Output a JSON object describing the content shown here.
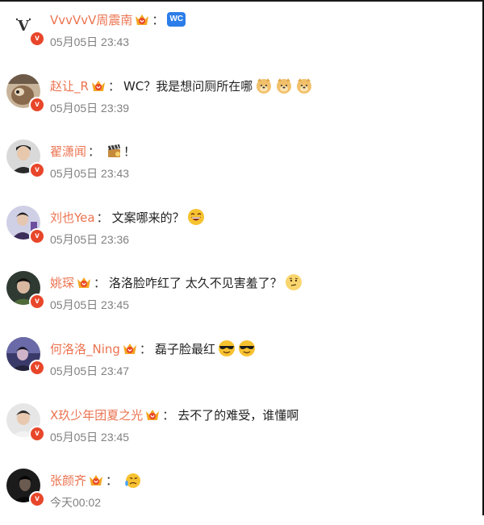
{
  "comments": [
    {
      "username": "VvvVvV周震南",
      "text": "",
      "time": "05月05日 23:43",
      "badge_text": "WC",
      "avatar": "v-logo-icon",
      "emojis": []
    },
    {
      "username": "赵让_R",
      "text": "WC？我是想问厕所在哪",
      "time": "05月05日 23:39",
      "avatar": "dog-photo-icon",
      "emojis": [
        "doge-icon",
        "doge-icon",
        "doge-icon"
      ]
    },
    {
      "username": "翟潇闻",
      "text": "",
      "time": "05月05日 23:43",
      "suffix": "！",
      "avatar": "person-photo-icon",
      "emojis": [
        "clapperboard-icon"
      ]
    },
    {
      "username": "刘也Yea",
      "text": "文案哪来的？",
      "time": "05月05日 23:36",
      "avatar": "person-photo-icon",
      "emojis": [
        "laughing-face-icon"
      ]
    },
    {
      "username": "姚琛",
      "text": "洛洛脸咋红了 太久不见害羞了？",
      "time": "05月05日 23:45",
      "avatar": "person-photo-icon",
      "emojis": [
        "thinking-face-icon"
      ]
    },
    {
      "username": "何洛洛_Ning",
      "text": "磊子脸最红",
      "time": "05月05日 23:47",
      "avatar": "person-photo-icon",
      "emojis": [
        "sunglasses-face-icon",
        "sunglasses-face-icon"
      ]
    },
    {
      "username": "X玖少年团夏之光",
      "text": "去不了的难受，谁懂啊",
      "time": "05月05日 23:45",
      "avatar": "person-photo-icon",
      "emojis": []
    },
    {
      "username": "张颜齐",
      "text": "",
      "time": "今天00:02",
      "avatar": "person-photo-icon",
      "emojis": [
        "crying-face-icon"
      ]
    }
  ],
  "colon": "：",
  "colors": {
    "username": "#eb7350",
    "time": "#808080",
    "verified_badge": "#e8462a"
  }
}
